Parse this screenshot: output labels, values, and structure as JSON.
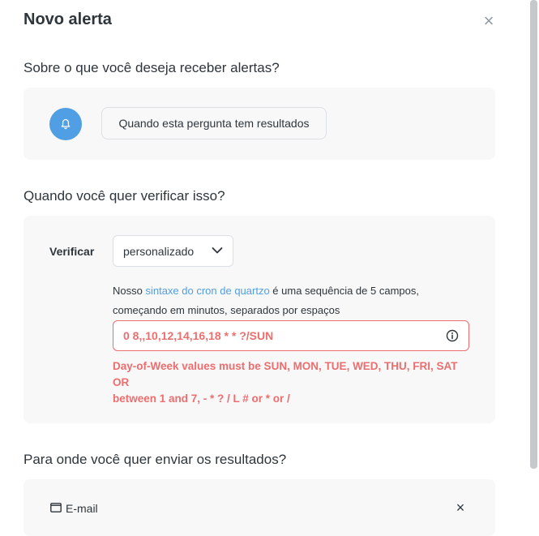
{
  "header": {
    "title": "Novo alerta",
    "close_glyph": "×"
  },
  "what": {
    "heading": "Sobre o que você deseja receber alertas?",
    "bell_icon": "bell-icon",
    "condition_label": "Quando esta pergunta tem resultados"
  },
  "schedule": {
    "heading": "Quando você quer verificar isso?",
    "verify_label": "Verificar",
    "frequency_value": "personalizado",
    "help_prefix": "Nosso ",
    "help_link": "sintaxe do cron de quartzo",
    "help_suffix_line1": " é uma sequência de 5 campos,",
    "help_line2": "começando em minutos, separados por espaços",
    "cron_value": "0 8,,10,12,14,16,18 * * ?/SUN",
    "error_line1": "Day-of-Week values must be SUN, MON, TUE, WED, THU, FRI, SAT OR",
    "error_line2": "between 1 and 7, - * ? / L # or * or /"
  },
  "destination": {
    "heading": "Para onde você quer enviar os resultados?",
    "channel_label": "E-mail",
    "remove_glyph": "×"
  },
  "colors": {
    "brand": "#509ee3",
    "error": "#ed6e6e",
    "card_bg": "#f8f8f9"
  }
}
